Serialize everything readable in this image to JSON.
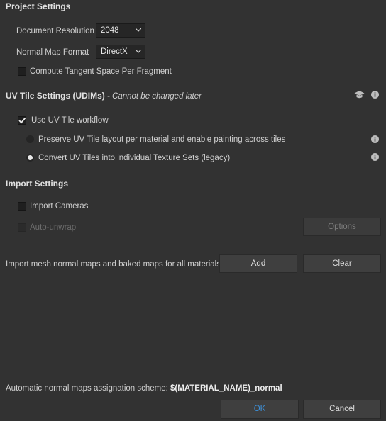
{
  "project_settings": {
    "title": "Project Settings",
    "document_resolution": {
      "label": "Document Resolution",
      "value": "2048"
    },
    "normal_map_format": {
      "label": "Normal Map Format",
      "value": "DirectX"
    },
    "compute_tangent": {
      "label": "Compute Tangent Space Per Fragment",
      "checked": false
    }
  },
  "uv_tile": {
    "title": "UV Tile Settings (UDIMs)",
    "subtitle": " - Cannot be changed later",
    "use_uv_tile": {
      "label": "Use UV Tile workflow",
      "checked": true
    },
    "options": [
      {
        "label": "Preserve UV Tile layout per material and enable painting across tiles",
        "selected": false
      },
      {
        "label": "Convert UV Tiles into individual Texture Sets (legacy)",
        "selected": true
      }
    ]
  },
  "import_settings": {
    "title": "Import Settings",
    "import_cameras": {
      "label": "Import Cameras",
      "checked": false
    },
    "auto_unwrap": {
      "label": "Auto-unwrap",
      "checked": false,
      "disabled": true
    },
    "options_button": "Options",
    "mesh_maps_text": "Import mesh normal maps and baked maps for all materials.",
    "add_button": "Add",
    "clear_button": "Clear"
  },
  "footer": {
    "scheme_label": "Automatic normal maps assignation scheme:",
    "scheme_value": "$(MATERIAL_NAME)_normal",
    "ok_button": "OK",
    "cancel_button": "Cancel"
  },
  "colors": {
    "background": "#323232",
    "accent": "#3d8fd6",
    "field": "#262626"
  },
  "icons": [
    "chevron-down-icon",
    "checkmark-icon",
    "graduation-cap-icon",
    "info-icon"
  ]
}
